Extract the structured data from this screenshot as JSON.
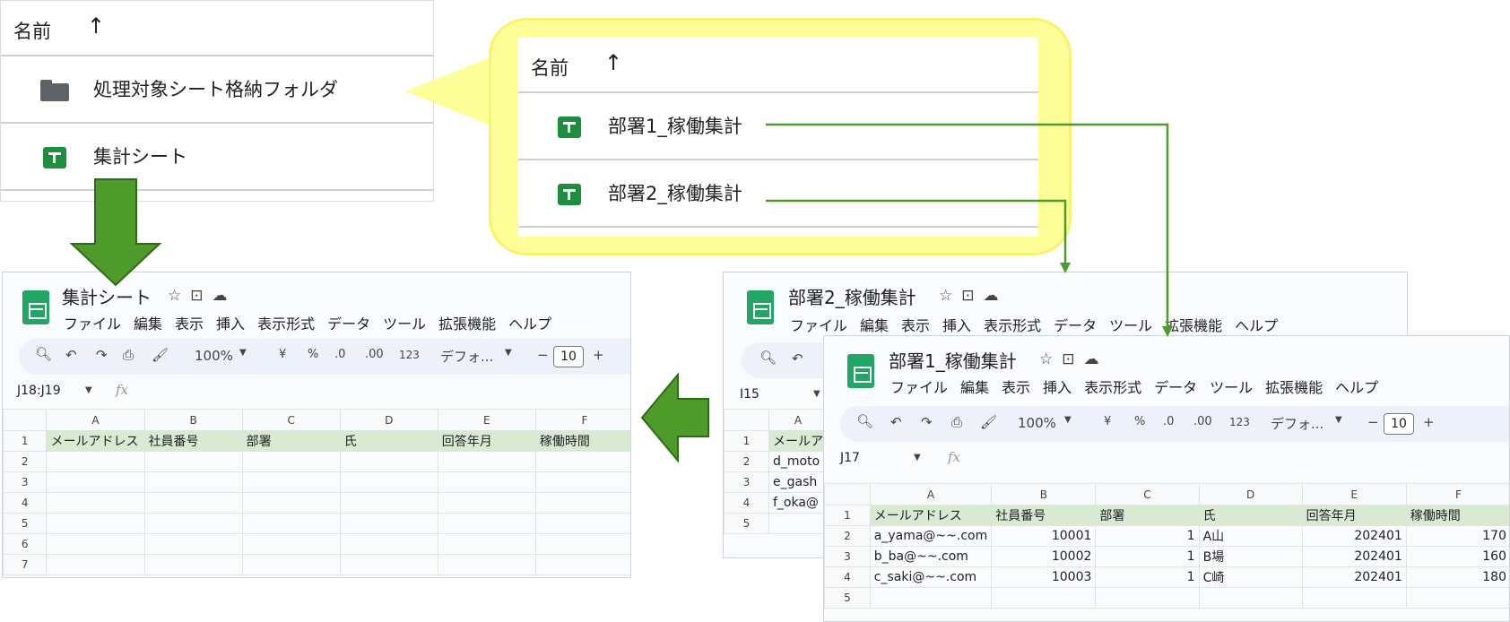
{
  "drive_list": {
    "header": {
      "name_label": "名前",
      "sort_arrow": "↑"
    },
    "items": [
      {
        "label": "処理対象シート格納フォルダ",
        "icon": "folder-icon"
      },
      {
        "label": "集計シート",
        "icon": "sheets-icon"
      }
    ]
  },
  "folder_popup": {
    "header": {
      "name_label": "名前",
      "sort_arrow": "↑"
    },
    "items": [
      {
        "label": "部署1_稼働集計",
        "icon": "sheets-icon"
      },
      {
        "label": "部署2_稼働集計",
        "icon": "sheets-icon"
      }
    ]
  },
  "common": {
    "menu": [
      "ファイル",
      "編集",
      "表示",
      "挿入",
      "表示形式",
      "データ",
      "ツール",
      "拡張機能",
      "ヘルプ"
    ],
    "toolbar": {
      "zoom": "100%",
      "currency": "¥",
      "percent": "%",
      "dec_less": ".0",
      "dec_more": ".00",
      "num_format": "123",
      "font": "デフォ...",
      "font_size": "10",
      "minus": "−",
      "plus": "+"
    },
    "fx": "fx",
    "columns": [
      "A",
      "B",
      "C",
      "D",
      "E",
      "F"
    ],
    "header_row": [
      "メールアドレス",
      "社員番号",
      "部署",
      "氏",
      "回答年月",
      "稼働時間"
    ]
  },
  "summary_sheet": {
    "title": "集計シート",
    "name_box": "J18:J19",
    "rows": [
      "1",
      "2",
      "3",
      "4",
      "5",
      "6",
      "7"
    ]
  },
  "dept2_sheet": {
    "title": "部署2_稼働集計",
    "name_box": "I15",
    "col_a_partial": "A",
    "rows": [
      {
        "n": "1",
        "a": "メールア"
      },
      {
        "n": "2",
        "a": "d_moto"
      },
      {
        "n": "3",
        "a": "e_gash"
      },
      {
        "n": "4",
        "a": "f_oka@"
      },
      {
        "n": "5",
        "a": ""
      }
    ]
  },
  "dept1_sheet": {
    "title": "部署1_稼働集計",
    "name_box": "J17",
    "rows": [
      {
        "n": "2",
        "cells": [
          "a_yama@~~.com",
          "10001",
          "1",
          "A山",
          "202401",
          "170"
        ]
      },
      {
        "n": "3",
        "cells": [
          "b_ba@~~.com",
          "10002",
          "1",
          "B場",
          "202401",
          "160"
        ]
      },
      {
        "n": "4",
        "cells": [
          "c_saki@~~.com",
          "10003",
          "1",
          "C崎",
          "202401",
          "180"
        ]
      },
      {
        "n": "5",
        "cells": [
          "",
          "",
          "",
          "",
          "",
          ""
        ]
      }
    ]
  },
  "colors": {
    "accent_arrow": "#4e9a2a",
    "callout": "#ffff99",
    "sheets_green": "#1e8e3e",
    "header_fill": "#d9ead3"
  }
}
